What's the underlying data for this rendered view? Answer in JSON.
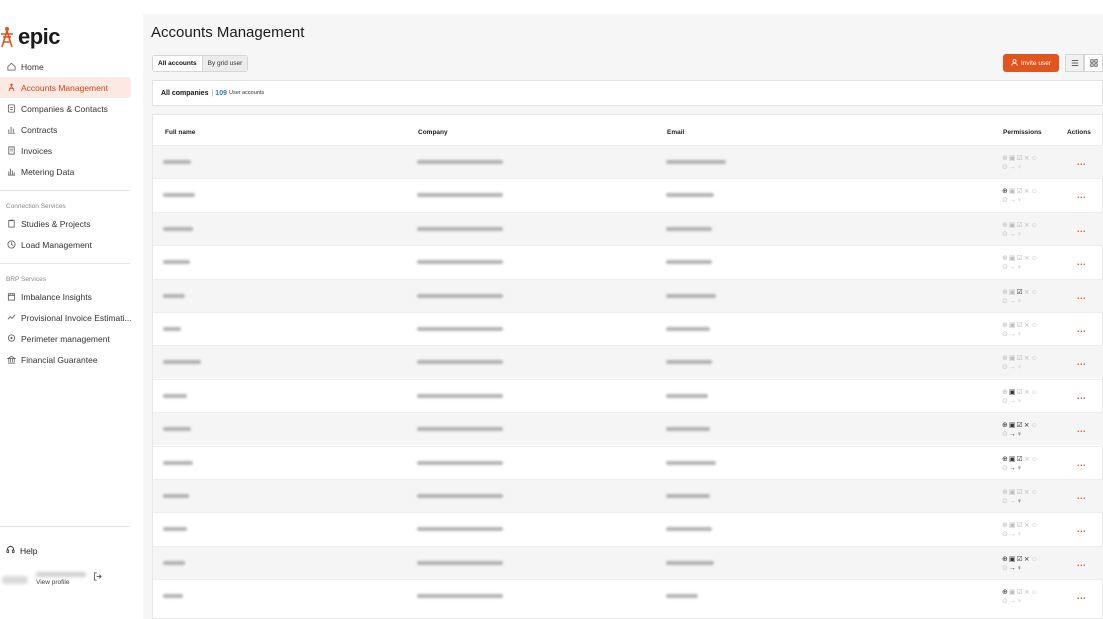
{
  "app": {
    "logo_text": "epic",
    "page_title": "Accounts Management",
    "accent_color": "#e2541d"
  },
  "sidebar": {
    "primary": [
      {
        "label": "Home",
        "icon": "home-icon"
      },
      {
        "label": "Accounts Management",
        "icon": "accounts-icon",
        "active": true
      },
      {
        "label": "Companies & Contacts",
        "icon": "contacts-icon"
      },
      {
        "label": "Contracts",
        "icon": "contracts-icon"
      },
      {
        "label": "Invoices",
        "icon": "invoice-icon"
      },
      {
        "label": "Metering Data",
        "icon": "chart-icon"
      }
    ],
    "section1_title": "Connection Services",
    "section1": [
      {
        "label": "Studies & Projects",
        "icon": "clipboard-icon"
      },
      {
        "label": "Load Management",
        "icon": "clock-icon"
      }
    ],
    "section2_title": "BRP Services",
    "section2": [
      {
        "label": "Imbalance Insights",
        "icon": "calendar-icon"
      },
      {
        "label": "Provisional Invoice Estimati...",
        "icon": "trend-icon"
      },
      {
        "label": "Perimeter management",
        "icon": "location-icon"
      },
      {
        "label": "Financial Guarantee",
        "icon": "bank-icon"
      }
    ],
    "help_label": "Help",
    "view_profile_label": "View profile"
  },
  "toolbar": {
    "tab_all": "All accounts",
    "tab_grid": "By grid user",
    "invite_label": "Invite user"
  },
  "summary": {
    "title": "All companies",
    "separator": "|",
    "count": "109",
    "count_label": "User accounts"
  },
  "table": {
    "columns": {
      "name": "Full name",
      "company": "Company",
      "email": "Email",
      "permissions": "Permissions",
      "actions": "Actions"
    },
    "actions_label": "...",
    "rows": [
      {
        "perm_dark": [
          false,
          false,
          false,
          false,
          false,
          false,
          false,
          false
        ]
      },
      {
        "perm_dark": [
          true,
          false,
          false,
          false,
          false,
          false,
          false,
          false
        ]
      },
      {
        "perm_dark": [
          false,
          false,
          false,
          false,
          false,
          false,
          false,
          false
        ]
      },
      {
        "perm_dark": [
          false,
          false,
          false,
          false,
          false,
          false,
          false,
          false
        ]
      },
      {
        "perm_dark": [
          false,
          false,
          true,
          false,
          false,
          false,
          false,
          false
        ]
      },
      {
        "perm_dark": [
          false,
          false,
          false,
          false,
          false,
          false,
          false,
          false
        ]
      },
      {
        "perm_dark": [
          false,
          false,
          false,
          false,
          false,
          false,
          false,
          false
        ]
      },
      {
        "perm_dark": [
          false,
          true,
          false,
          false,
          false,
          false,
          false,
          false
        ]
      },
      {
        "perm_dark": [
          true,
          true,
          true,
          true,
          false,
          false,
          true,
          true
        ]
      },
      {
        "perm_dark": [
          true,
          true,
          true,
          false,
          false,
          false,
          true,
          true
        ]
      },
      {
        "perm_dark": [
          false,
          false,
          false,
          false,
          false,
          false,
          false,
          true
        ]
      },
      {
        "perm_dark": [
          false,
          false,
          false,
          false,
          false,
          false,
          false,
          false
        ]
      },
      {
        "perm_dark": [
          true,
          true,
          true,
          true,
          false,
          false,
          true,
          true
        ]
      },
      {
        "perm_dark": [
          true,
          false,
          false,
          false,
          false,
          false,
          false,
          false
        ]
      }
    ]
  }
}
